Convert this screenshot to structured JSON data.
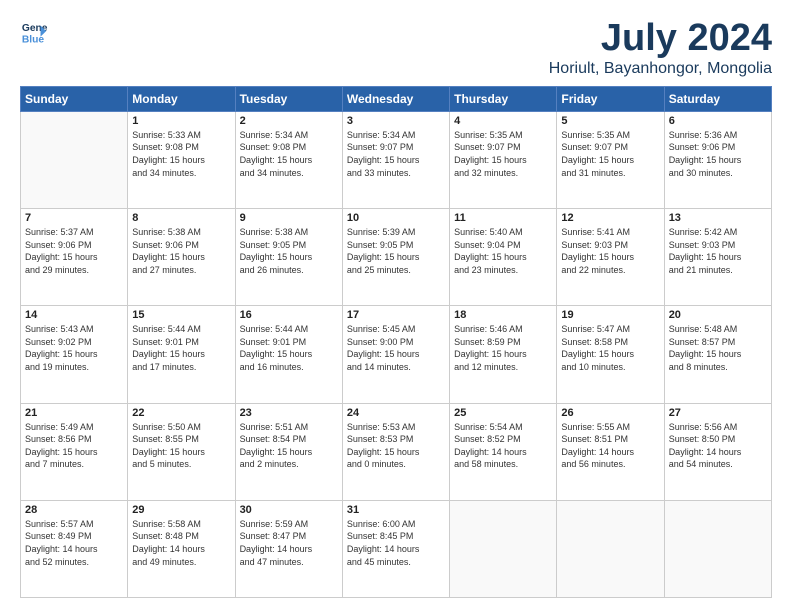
{
  "logo": {
    "line1": "General",
    "line2": "Blue"
  },
  "title": "July 2024",
  "location": "Horiult, Bayanhongor, Mongolia",
  "weekdays": [
    "Sunday",
    "Monday",
    "Tuesday",
    "Wednesday",
    "Thursday",
    "Friday",
    "Saturday"
  ],
  "weeks": [
    [
      {
        "day": "",
        "info": ""
      },
      {
        "day": "1",
        "info": "Sunrise: 5:33 AM\nSunset: 9:08 PM\nDaylight: 15 hours\nand 34 minutes."
      },
      {
        "day": "2",
        "info": "Sunrise: 5:34 AM\nSunset: 9:08 PM\nDaylight: 15 hours\nand 34 minutes."
      },
      {
        "day": "3",
        "info": "Sunrise: 5:34 AM\nSunset: 9:07 PM\nDaylight: 15 hours\nand 33 minutes."
      },
      {
        "day": "4",
        "info": "Sunrise: 5:35 AM\nSunset: 9:07 PM\nDaylight: 15 hours\nand 32 minutes."
      },
      {
        "day": "5",
        "info": "Sunrise: 5:35 AM\nSunset: 9:07 PM\nDaylight: 15 hours\nand 31 minutes."
      },
      {
        "day": "6",
        "info": "Sunrise: 5:36 AM\nSunset: 9:06 PM\nDaylight: 15 hours\nand 30 minutes."
      }
    ],
    [
      {
        "day": "7",
        "info": "Sunrise: 5:37 AM\nSunset: 9:06 PM\nDaylight: 15 hours\nand 29 minutes."
      },
      {
        "day": "8",
        "info": "Sunrise: 5:38 AM\nSunset: 9:06 PM\nDaylight: 15 hours\nand 27 minutes."
      },
      {
        "day": "9",
        "info": "Sunrise: 5:38 AM\nSunset: 9:05 PM\nDaylight: 15 hours\nand 26 minutes."
      },
      {
        "day": "10",
        "info": "Sunrise: 5:39 AM\nSunset: 9:05 PM\nDaylight: 15 hours\nand 25 minutes."
      },
      {
        "day": "11",
        "info": "Sunrise: 5:40 AM\nSunset: 9:04 PM\nDaylight: 15 hours\nand 23 minutes."
      },
      {
        "day": "12",
        "info": "Sunrise: 5:41 AM\nSunset: 9:03 PM\nDaylight: 15 hours\nand 22 minutes."
      },
      {
        "day": "13",
        "info": "Sunrise: 5:42 AM\nSunset: 9:03 PM\nDaylight: 15 hours\nand 21 minutes."
      }
    ],
    [
      {
        "day": "14",
        "info": "Sunrise: 5:43 AM\nSunset: 9:02 PM\nDaylight: 15 hours\nand 19 minutes."
      },
      {
        "day": "15",
        "info": "Sunrise: 5:44 AM\nSunset: 9:01 PM\nDaylight: 15 hours\nand 17 minutes."
      },
      {
        "day": "16",
        "info": "Sunrise: 5:44 AM\nSunset: 9:01 PM\nDaylight: 15 hours\nand 16 minutes."
      },
      {
        "day": "17",
        "info": "Sunrise: 5:45 AM\nSunset: 9:00 PM\nDaylight: 15 hours\nand 14 minutes."
      },
      {
        "day": "18",
        "info": "Sunrise: 5:46 AM\nSunset: 8:59 PM\nDaylight: 15 hours\nand 12 minutes."
      },
      {
        "day": "19",
        "info": "Sunrise: 5:47 AM\nSunset: 8:58 PM\nDaylight: 15 hours\nand 10 minutes."
      },
      {
        "day": "20",
        "info": "Sunrise: 5:48 AM\nSunset: 8:57 PM\nDaylight: 15 hours\nand 8 minutes."
      }
    ],
    [
      {
        "day": "21",
        "info": "Sunrise: 5:49 AM\nSunset: 8:56 PM\nDaylight: 15 hours\nand 7 minutes."
      },
      {
        "day": "22",
        "info": "Sunrise: 5:50 AM\nSunset: 8:55 PM\nDaylight: 15 hours\nand 5 minutes."
      },
      {
        "day": "23",
        "info": "Sunrise: 5:51 AM\nSunset: 8:54 PM\nDaylight: 15 hours\nand 2 minutes."
      },
      {
        "day": "24",
        "info": "Sunrise: 5:53 AM\nSunset: 8:53 PM\nDaylight: 15 hours\nand 0 minutes."
      },
      {
        "day": "25",
        "info": "Sunrise: 5:54 AM\nSunset: 8:52 PM\nDaylight: 14 hours\nand 58 minutes."
      },
      {
        "day": "26",
        "info": "Sunrise: 5:55 AM\nSunset: 8:51 PM\nDaylight: 14 hours\nand 56 minutes."
      },
      {
        "day": "27",
        "info": "Sunrise: 5:56 AM\nSunset: 8:50 PM\nDaylight: 14 hours\nand 54 minutes."
      }
    ],
    [
      {
        "day": "28",
        "info": "Sunrise: 5:57 AM\nSunset: 8:49 PM\nDaylight: 14 hours\nand 52 minutes."
      },
      {
        "day": "29",
        "info": "Sunrise: 5:58 AM\nSunset: 8:48 PM\nDaylight: 14 hours\nand 49 minutes."
      },
      {
        "day": "30",
        "info": "Sunrise: 5:59 AM\nSunset: 8:47 PM\nDaylight: 14 hours\nand 47 minutes."
      },
      {
        "day": "31",
        "info": "Sunrise: 6:00 AM\nSunset: 8:45 PM\nDaylight: 14 hours\nand 45 minutes."
      },
      {
        "day": "",
        "info": ""
      },
      {
        "day": "",
        "info": ""
      },
      {
        "day": "",
        "info": ""
      }
    ]
  ]
}
